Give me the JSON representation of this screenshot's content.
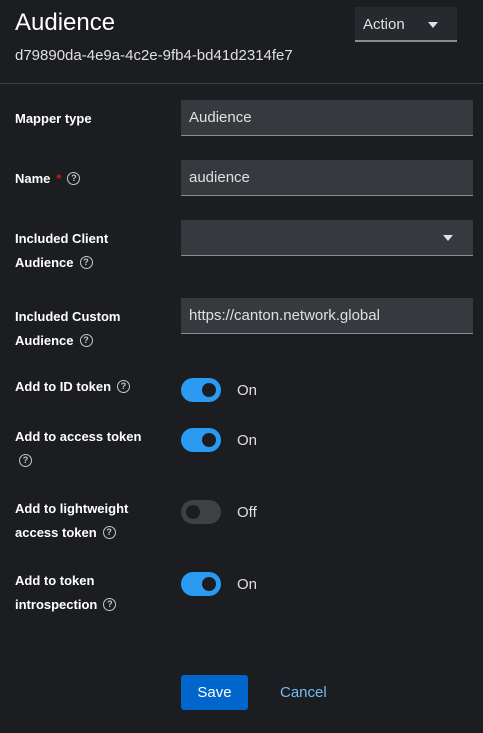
{
  "header": {
    "title": "Audience",
    "id": "d79890da-4e9a-4c2e-9fb4-bd41d2314fe7",
    "action_label": "Action"
  },
  "form": {
    "mapper_type": {
      "label": "Mapper type",
      "value": "Audience"
    },
    "name": {
      "label": "Name",
      "required_mark": "*",
      "value": "audience"
    },
    "included_client_audience": {
      "label_line1": "Included Client",
      "label_line2": "Audience",
      "value": ""
    },
    "included_custom_audience": {
      "label_line1": "Included Custom",
      "label_line2": "Audience",
      "value": "https://canton.network.global"
    },
    "add_to_id_token": {
      "label": "Add to ID token",
      "state": "On"
    },
    "add_to_access_token": {
      "label": "Add to access token",
      "state": "On"
    },
    "add_to_lightweight_access_token": {
      "label_line1": "Add to lightweight",
      "label_line2": "access token",
      "state": "Off"
    },
    "add_to_token_introspection": {
      "label_line1": "Add to token",
      "label_line2": "introspection",
      "state": "On"
    }
  },
  "buttons": {
    "save": "Save",
    "cancel": "Cancel"
  },
  "icons": {
    "help": "help-circle-icon",
    "caret": "caret-down-icon"
  },
  "colors": {
    "accent": "#2b9af3",
    "primary": "#0066cc",
    "link": "#73bcf7",
    "required": "#c9190b"
  }
}
